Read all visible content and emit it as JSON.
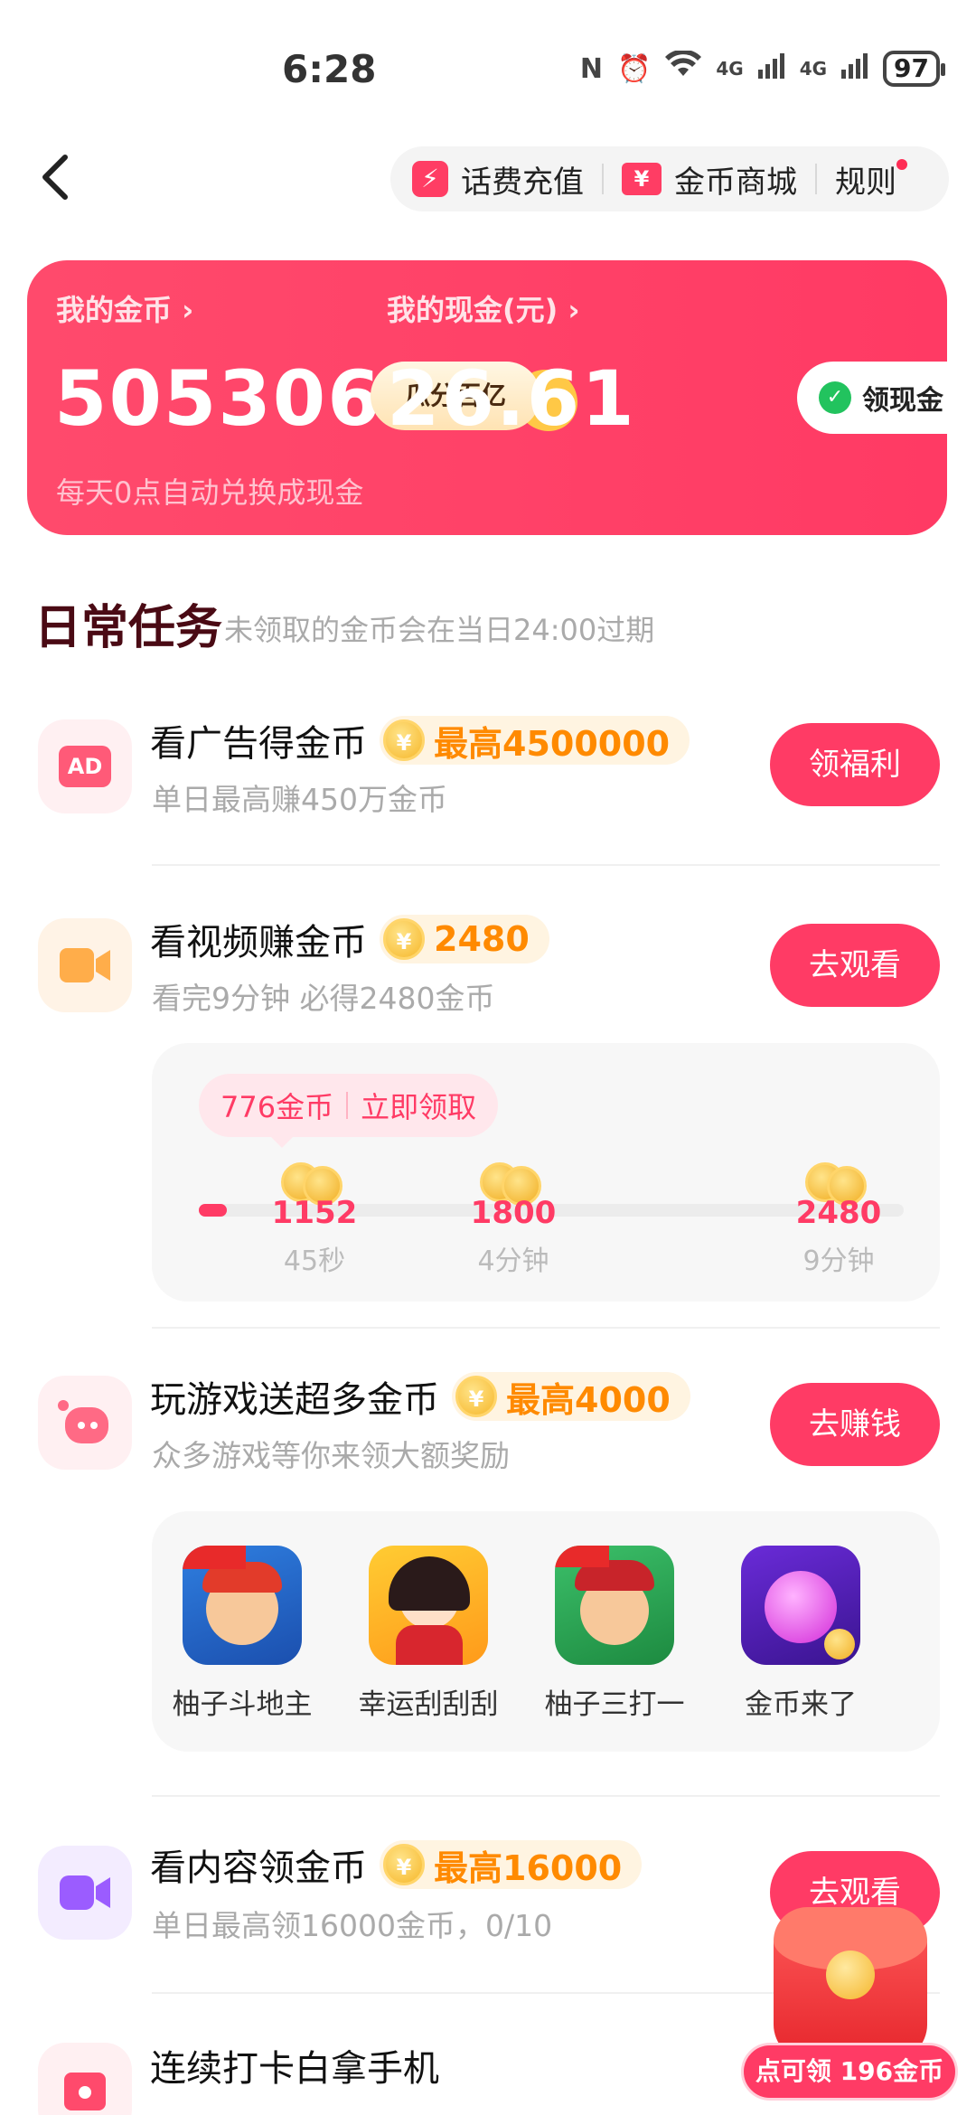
{
  "status_bar": {
    "time": "6:28",
    "network_1": "4G",
    "network_2": "4G",
    "wifi_sub": "6",
    "battery": "97"
  },
  "top_nav": {
    "phone_recharge": "话费充值",
    "coin_mall": "金币商城",
    "rules": "规则",
    "phone_icon": "¥",
    "mall_icon": "¥"
  },
  "wallet": {
    "coins_label": "我的金币 ›",
    "coins_value": "505306",
    "cash_label": "我的现金(元) ›",
    "cash_value": "26.61",
    "split_button": "瓜分百亿",
    "withdraw_button": "领现金",
    "note": "每天0点自动兑换成现金",
    "accent_color": "#ff3b65"
  },
  "daily": {
    "title": "日常任务",
    "subtitle": "未领取的金币会在当日24:00过期"
  },
  "tasks": [
    {
      "title": "看广告得金币",
      "reward": "最高4500000",
      "desc": "单日最高赚450万金币",
      "button": "领福利",
      "icon": "AD"
    },
    {
      "title": "看视频赚金币",
      "reward": "2480",
      "desc": "看完9分钟 必得2480金币",
      "button": "去观看"
    },
    {
      "title": "玩游戏送超多金币",
      "reward": "最高4000",
      "desc": "众多游戏等你来领大额奖励",
      "button": "去赚钱"
    },
    {
      "title": "看内容领金币",
      "reward": "最高16000",
      "desc": "单日最高领16000金币，0/10",
      "button": "去观看"
    },
    {
      "title": "连续打卡白拿手机"
    }
  ],
  "video_progress": {
    "tip_coins": "776金币",
    "tip_action": "立即领取",
    "progress_fraction": 0.04,
    "milestones": [
      {
        "value": "1152",
        "time": "45秒"
      },
      {
        "value": "1800",
        "time": "4分钟"
      },
      {
        "value": "2480",
        "time": "9分钟"
      }
    ]
  },
  "games": [
    {
      "name": "柚子斗地主"
    },
    {
      "name": "幸运刮刮刮"
    },
    {
      "name": "柚子三打一"
    },
    {
      "name": "金币来了"
    }
  ],
  "floating": {
    "label": "点可领 196金币"
  }
}
